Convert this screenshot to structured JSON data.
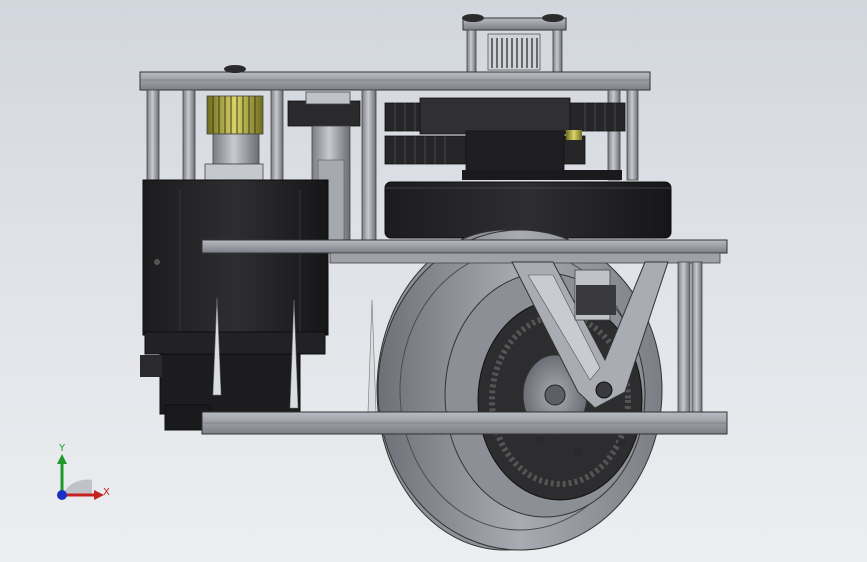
{
  "viewport": {
    "background_top": "#d2d6dd",
    "background_bottom": "#eceef1"
  },
  "model": {
    "description_icon": "cad-assembly-drive-wheel"
  },
  "triad": {
    "y_label": "Y",
    "x_label": "X",
    "y_color": "#1e9a2a",
    "x_color": "#c62020",
    "z_color": "#1a2ec8"
  }
}
